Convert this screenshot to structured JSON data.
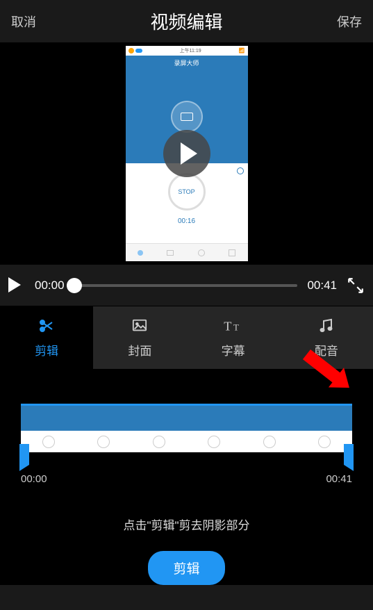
{
  "header": {
    "cancel": "取消",
    "title": "视频编辑",
    "save": "保存"
  },
  "preview": {
    "status_time": "上午11:19",
    "app_title": "录屏大师",
    "stop_label": "STOP",
    "rec_time": "00:16"
  },
  "playback": {
    "current": "00:00",
    "total": "00:41"
  },
  "tabs": [
    {
      "id": "edit",
      "label": "剪辑",
      "icon": "scissors-icon"
    },
    {
      "id": "cover",
      "label": "封面",
      "icon": "image-icon"
    },
    {
      "id": "subtitle",
      "label": "字幕",
      "icon": "text-icon"
    },
    {
      "id": "voice",
      "label": "配音",
      "icon": "music-icon"
    }
  ],
  "timeline": {
    "start": "00:00",
    "end": "00:41"
  },
  "hint": "点击\"剪辑\"剪去阴影部分",
  "action_label": "剪辑"
}
